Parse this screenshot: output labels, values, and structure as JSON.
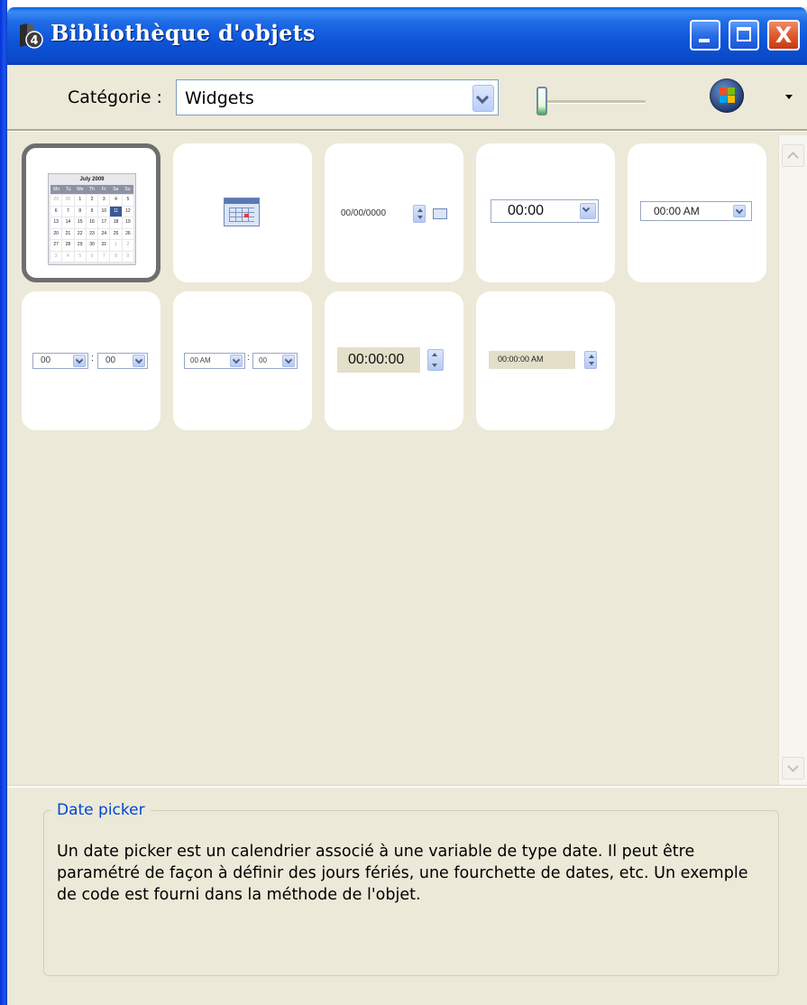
{
  "window": {
    "title": "Bibliothèque d'objets",
    "app_icon": "4d-icon",
    "controls": [
      "minimize",
      "maximize",
      "close"
    ],
    "close_glyph": "X"
  },
  "toolbar": {
    "category_label": "Catégorie :",
    "category_value": "Widgets",
    "zoom_slider_level": 0.0,
    "theme_icon": "windows-logo-icon"
  },
  "tiles": [
    {
      "name": "Calendar widget",
      "selected": true,
      "preview": "calendar",
      "calendar": {
        "month": "July 2009",
        "weekdays": [
          "Mo",
          "Tu",
          "We",
          "Th",
          "Fr",
          "Sa",
          "Su"
        ],
        "days": [
          "29",
          "30",
          "1",
          "2",
          "3",
          "4",
          "5",
          "6",
          "7",
          "8",
          "9",
          "10",
          "11",
          "12",
          "13",
          "14",
          "15",
          "16",
          "17",
          "18",
          "19",
          "20",
          "21",
          "22",
          "23",
          "24",
          "25",
          "26",
          "27",
          "28",
          "29",
          "30",
          "31",
          "1",
          "2",
          "3",
          "4",
          "5",
          "6",
          "7",
          "8",
          "9"
        ],
        "selected_day": "11"
      }
    },
    {
      "name": "Calendar icon",
      "preview": "calendar-icon"
    },
    {
      "name": "Date entry",
      "preview": "date-spin",
      "text": "00/00/0000"
    },
    {
      "name": "Time dropdown",
      "preview": "time-dropdown",
      "text": "00:00"
    },
    {
      "name": "Time AM dropdown",
      "preview": "time-am-dropdown",
      "text": "00:00 AM"
    },
    {
      "name": "Hour minute dropdowns",
      "preview": "hm-dropdowns",
      "text_a": "00",
      "text_b": "00"
    },
    {
      "name": "AM hour minute dropdowns",
      "preview": "am-hm-dropdowns",
      "text_a": "00 AM",
      "text_b": "00"
    },
    {
      "name": "Time spinner",
      "preview": "time-spin",
      "text": "00:00:00"
    },
    {
      "name": "Time AM spinner",
      "preview": "time-am-spin",
      "text": "00:00:00 AM"
    }
  ],
  "description": {
    "title": "Date picker",
    "text": "Un date picker est un calendrier associé à une variable de type date. Il peut être paramétré de façon à définir des jours fériés, une fourchette de dates, etc. Un exemple de code est fourni dans la méthode de l'objet."
  }
}
